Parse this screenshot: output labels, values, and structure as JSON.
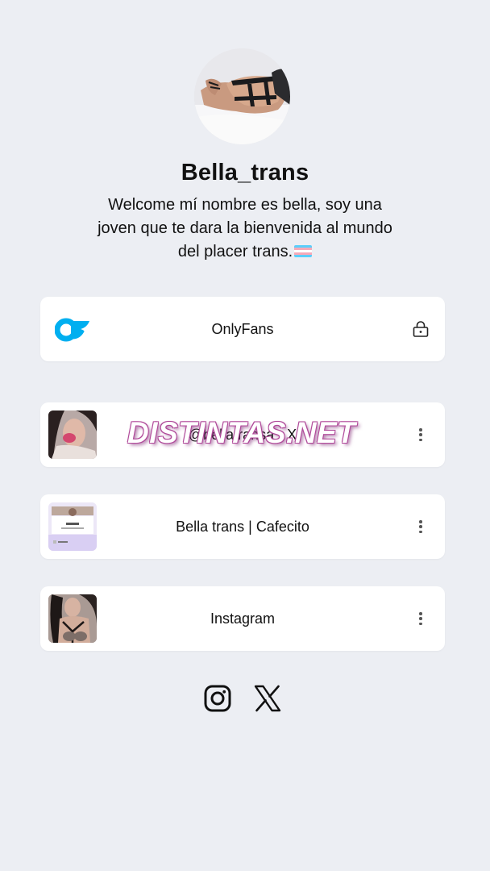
{
  "profile": {
    "name": "Bella_trans",
    "bio": "Welcome mí nombre es bella, soy una joven que te dara la bienvenida al mundo del placer trans."
  },
  "links": [
    {
      "label": "OnlyFans",
      "icon": "onlyfans-icon",
      "trailing": "lock-icon"
    },
    {
      "label": "@bellatransa · X",
      "thumb": "photo-thumbnail",
      "trailing": "more-options-icon"
    },
    {
      "label": "Bella trans | Cafecito",
      "thumb": "cafecito-thumbnail",
      "trailing": "more-options-icon"
    },
    {
      "label": "Instagram",
      "thumb": "photo-thumbnail",
      "trailing": "more-options-icon"
    }
  ],
  "watermark": "DISTINTAS.NET",
  "social_icons": [
    "instagram-icon",
    "x-icon"
  ],
  "colors": {
    "background": "#eceef3",
    "card": "#ffffff",
    "onlyfans_blue": "#00aff0",
    "text": "#111111"
  }
}
